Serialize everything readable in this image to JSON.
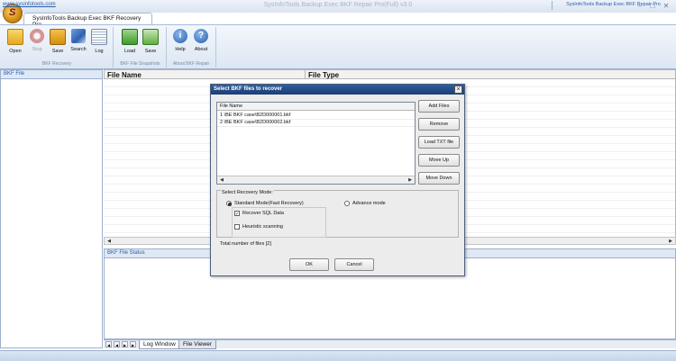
{
  "window": {
    "title": "SysInfoTools Backup Exec BKF Repair Pro(Full) v3.0",
    "tab": "SysInfoTools Backup Exec BKF Recovery Pro"
  },
  "ribbon": {
    "groups": [
      {
        "label": "BKF Recovery",
        "buttons": [
          {
            "label": "Open",
            "icon": "folder-open-icon"
          },
          {
            "label": "Stop",
            "icon": "stop-icon"
          },
          {
            "label": "Save",
            "icon": "save-icon"
          },
          {
            "label": "Search",
            "icon": "search-icon"
          },
          {
            "label": "Log",
            "icon": "log-icon"
          }
        ]
      },
      {
        "label": "BKF File Snapshots",
        "buttons": [
          {
            "label": "Load",
            "icon": "load-icon"
          },
          {
            "label": "Save",
            "icon": "save-snapshot-icon"
          }
        ]
      },
      {
        "label": "About BKF Repair",
        "buttons": [
          {
            "label": "Help",
            "icon": "info-icon"
          },
          {
            "label": "About",
            "icon": "help-icon"
          }
        ]
      }
    ]
  },
  "left_panel": {
    "header": "BKF File"
  },
  "main_list": {
    "columns": [
      "File Name",
      "File Type"
    ]
  },
  "status_panel": {
    "header": "BKF File Status"
  },
  "bottom_tabs": [
    "Log Window",
    "File Viewer"
  ],
  "statusbar": {
    "link": "www.sysinfotools.com",
    "right": "SysInfoTools Backup Exec BKF Repair Pro"
  },
  "dialog": {
    "title": "Select BKF files to recover",
    "list_header": "File Name",
    "files": [
      "1 \\BE BKF case\\B2D000001.bkf",
      "2 \\BE BKF case\\B2D000002.bkf"
    ],
    "buttons": {
      "add": "Add Files",
      "remove": "Remove",
      "load_txt": "Load TXT file",
      "move_up": "Move Up",
      "move_down": "Move Down"
    },
    "mode_legend": "Select Recovery Mode:",
    "standard_mode": "Standard Mode(Fast Recovery)",
    "recover_sql": "Recover SQL Data",
    "heuristic": "Heuristic scanning",
    "advance_mode": "Advance mode",
    "total_label": "Total number of files [2]",
    "ok": "OK",
    "cancel": "Cancel"
  }
}
